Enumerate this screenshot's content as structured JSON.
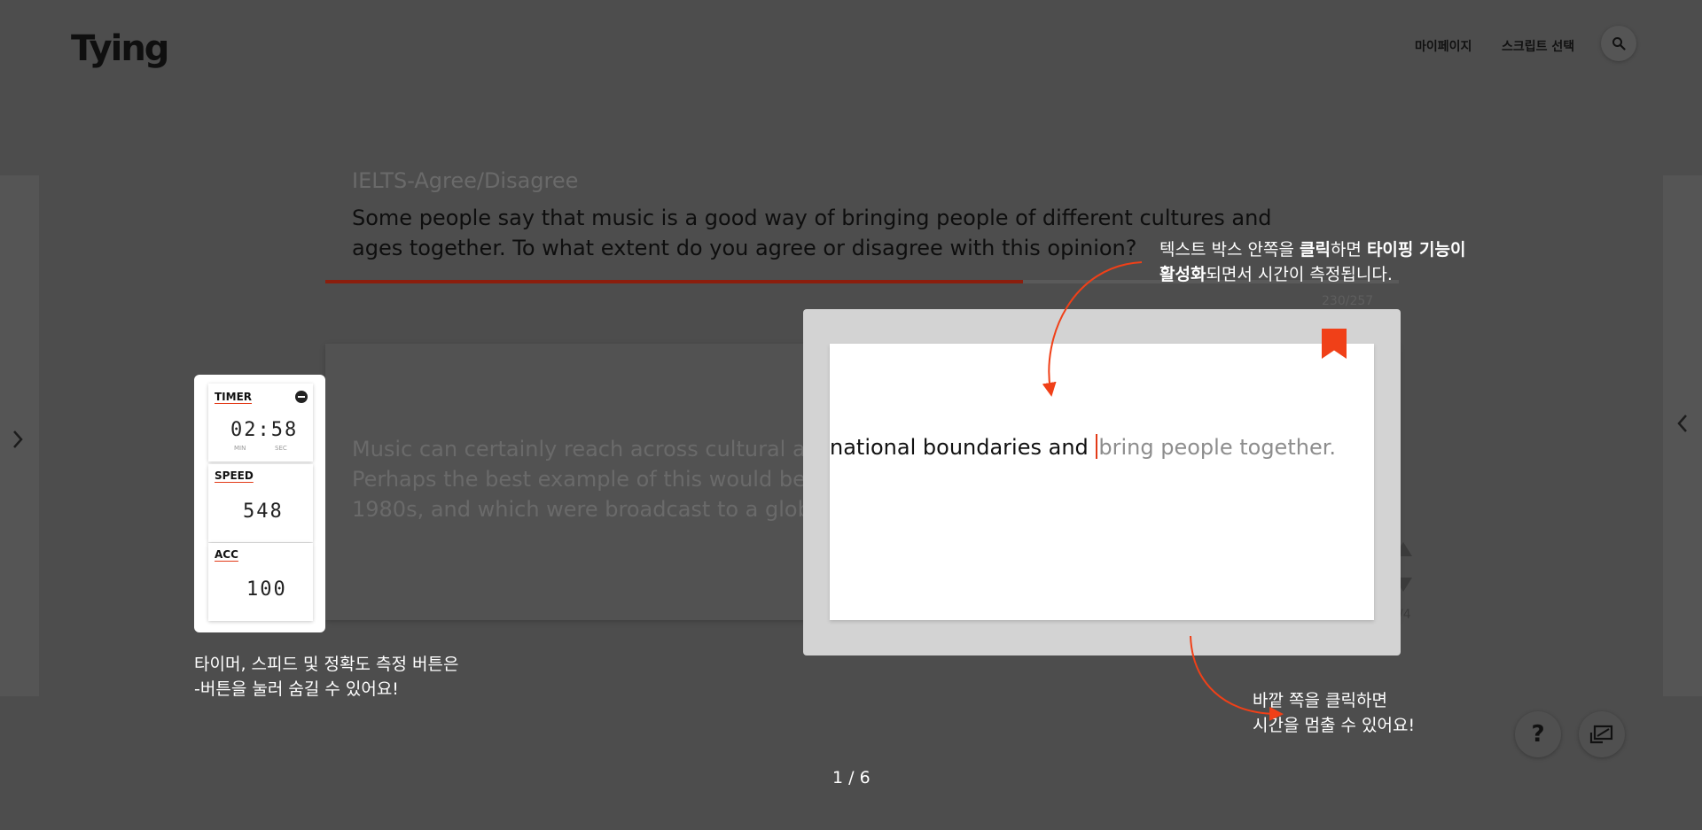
{
  "header": {
    "logo": "Tying",
    "nav": {
      "mypage": "마이페이지",
      "script_select": "스크립트 선택"
    },
    "search_icon": "search-icon"
  },
  "main": {
    "category": "IELTS-Agree/Disagree",
    "question": "Some people say that music is a good way of bringing people of different cultures and ages together.  To what extent do you agree or disagree with this opinion?",
    "char_count": "230/257",
    "progress_percent": 65,
    "passage": "Music can certainly reach across cultural and national boundaries and bring people together. Perhaps the best example of this would be the Live Aid concerts that took place back in the 1980s, and which were broadcast to a global audience.",
    "page_fragment": "/4"
  },
  "highlight": {
    "typed": "national boundaries and",
    "untyped": "bring people together."
  },
  "stats": {
    "timer": {
      "label": "TIMER",
      "value": "02:58",
      "min_label": "MIN",
      "sec_label": "SEC"
    },
    "speed": {
      "label": "SPEED",
      "value": "548"
    },
    "accuracy": {
      "label": "ACC",
      "value": "100"
    }
  },
  "annotations": {
    "top": {
      "p1": "텍스트 박스 안쪽을 ",
      "b1": "클릭",
      "p2": "하면 ",
      "b2": "타이핑 기능이",
      "b3": "활성화",
      "p3": "되면서 시간이 측정됩니다."
    },
    "left": {
      "line1": "타이머, 스피드 및 정확도 측정 버튼은",
      "line2": "-버튼을 눌러 숨길 수 있어요!"
    },
    "bottom": {
      "line1": "바깥 쪽을 클릭하면",
      "line2": "시간을 멈출 수 있어요!"
    }
  },
  "footer": {
    "pager": "1 / 6",
    "help_label": "?"
  },
  "colors": {
    "accent": "#f04018",
    "overlay": "#4d4d4d"
  }
}
